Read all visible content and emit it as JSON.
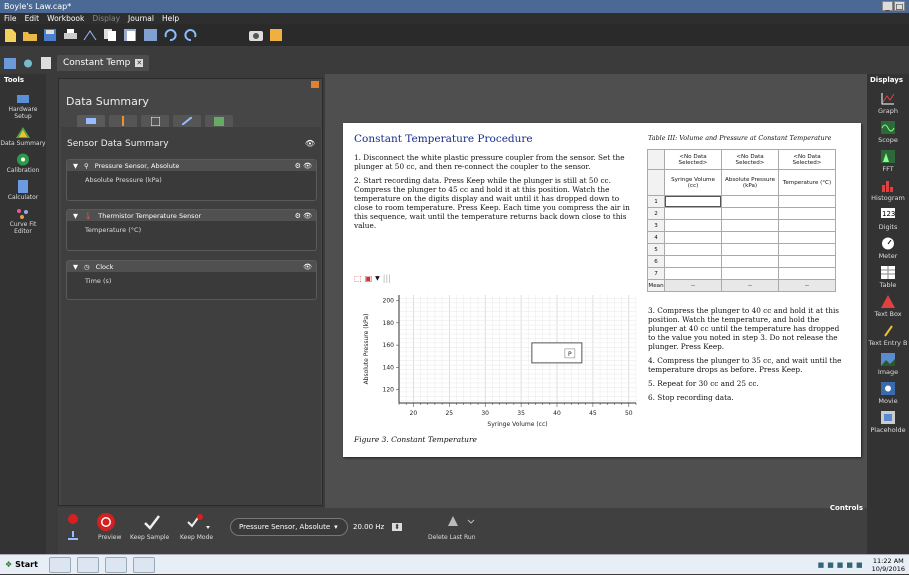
{
  "window": {
    "title": "Boyle's Law.cap*",
    "controls": [
      "_",
      "□"
    ]
  },
  "menu": [
    {
      "label": "File",
      "enabled": true
    },
    {
      "label": "Edit",
      "enabled": true
    },
    {
      "label": "Workbook",
      "enabled": true
    },
    {
      "label": "Display",
      "enabled": false
    },
    {
      "label": "Journal",
      "enabled": true
    },
    {
      "label": "Help",
      "enabled": true
    }
  ],
  "page_tab": {
    "label": "Constant Temp"
  },
  "tools": {
    "header": "Tools",
    "items": [
      {
        "label": "Hardware Setup",
        "icon": "hardware-icon"
      },
      {
        "label": "Data Summary",
        "icon": "data-summary-icon"
      },
      {
        "label": "Calibration",
        "icon": "calibration-icon"
      },
      {
        "label": "Calculator",
        "icon": "calculator-icon"
      },
      {
        "label": "Curve Fit Editor",
        "icon": "curve-fit-icon"
      }
    ]
  },
  "displays": {
    "header": "Displays",
    "items": [
      {
        "label": "Graph",
        "icon": "graph-icon"
      },
      {
        "label": "Scope",
        "icon": "scope-icon"
      },
      {
        "label": "FFT",
        "icon": "fft-icon"
      },
      {
        "label": "Histogram",
        "icon": "histogram-icon"
      },
      {
        "label": "Digits",
        "icon": "digits-icon"
      },
      {
        "label": "Meter",
        "icon": "meter-icon"
      },
      {
        "label": "Table",
        "icon": "table-icon"
      },
      {
        "label": "Text Box",
        "icon": "text-box-icon"
      },
      {
        "label": "Text Entry B",
        "icon": "text-entry-icon"
      },
      {
        "label": "Image",
        "icon": "image-icon"
      },
      {
        "label": "Movie",
        "icon": "movie-icon"
      },
      {
        "label": "Placeholde",
        "icon": "placeholder-icon"
      }
    ]
  },
  "data_summary": {
    "title": "Data Summary",
    "section": "Sensor Data Summary",
    "sensors": [
      {
        "name": "Pressure Sensor, Absolute",
        "measurement": "Absolute Pressure (kPa)"
      },
      {
        "name": "Thermistor Temperature Sensor",
        "measurement": "Temperature (°C)"
      },
      {
        "name": "Clock",
        "measurement": "Time (s)"
      }
    ]
  },
  "controls": {
    "label": "Controls",
    "preview": "Preview",
    "keep_sample": "Keep Sample",
    "keep_mode": "Keep Mode",
    "sensor": "Pressure Sensor, Absolute",
    "rate": "20.00 Hz",
    "delete_last_run": "Delete Last Run"
  },
  "page": {
    "heading": "Constant Temperature Procedure",
    "steps": [
      "1. Disconnect the white plastic pressure coupler from the sensor.  Set the plunger at 50 cc, and then re-connect the coupler to the sensor.",
      "2. Start recording data. Press Keep while the plunger is still at 50 cc. Compress the plunger to 45 cc and hold it at this position.  Watch the temperature on the digits display and wait until it has dropped down to close to room temperature. Press Keep. Each time you compress the air in this sequence, wait until the temperature returns back down close to this value."
    ],
    "steps_right": [
      "3. Compress the plunger to 40 cc and hold it at this position. Watch the temperature, and hold the plunger at 40 cc until the temperature has dropped to the value you noted in step 3. Do not release the plunger. Press Keep.",
      "4. Compress the plunger to 35 cc, and wait until the temperature drops as before. Press Keep.",
      "5. Repeat for 30 cc and 25 cc.",
      "6. Stop recording data."
    ],
    "table_caption": "Table III: Volume and Pressure at Constant Temperature",
    "table": {
      "top_headers": [
        "<No Data Selected>",
        "<No Data Selected>",
        "<No Data Selected>"
      ],
      "col_headers": [
        "Syringe Volume (cc)",
        "Absolute Pressure (kPa)",
        "Temperature (°C)"
      ],
      "rows": [
        "1",
        "2",
        "3",
        "4",
        "5",
        "6",
        "7"
      ],
      "mean_label": "Mean",
      "mean_values": [
        "--",
        "--",
        "--"
      ]
    },
    "figure_caption": "Figure 3. Constant Temperature"
  },
  "chart_data": {
    "type": "scatter",
    "xlabel": "Syringe Volume (cc)",
    "ylabel": "Absolute Pressure (kPa)",
    "xlim": [
      18,
      51
    ],
    "ylim": [
      108,
      205
    ],
    "xticks": [
      "20",
      "25",
      "30",
      "35",
      "40",
      "45",
      "50"
    ],
    "yticks": [
      "120",
      "140",
      "160",
      "180",
      "200"
    ],
    "series": [],
    "grid": true,
    "legend": {
      "label": "P",
      "placement": "right"
    }
  },
  "taskbar": {
    "start": "Start",
    "time": "11:22 AM",
    "date": "10/9/2016"
  },
  "colors": {
    "accent": "#1a2d8c",
    "record": "#d42020",
    "titlebar": "#4a6a95"
  }
}
